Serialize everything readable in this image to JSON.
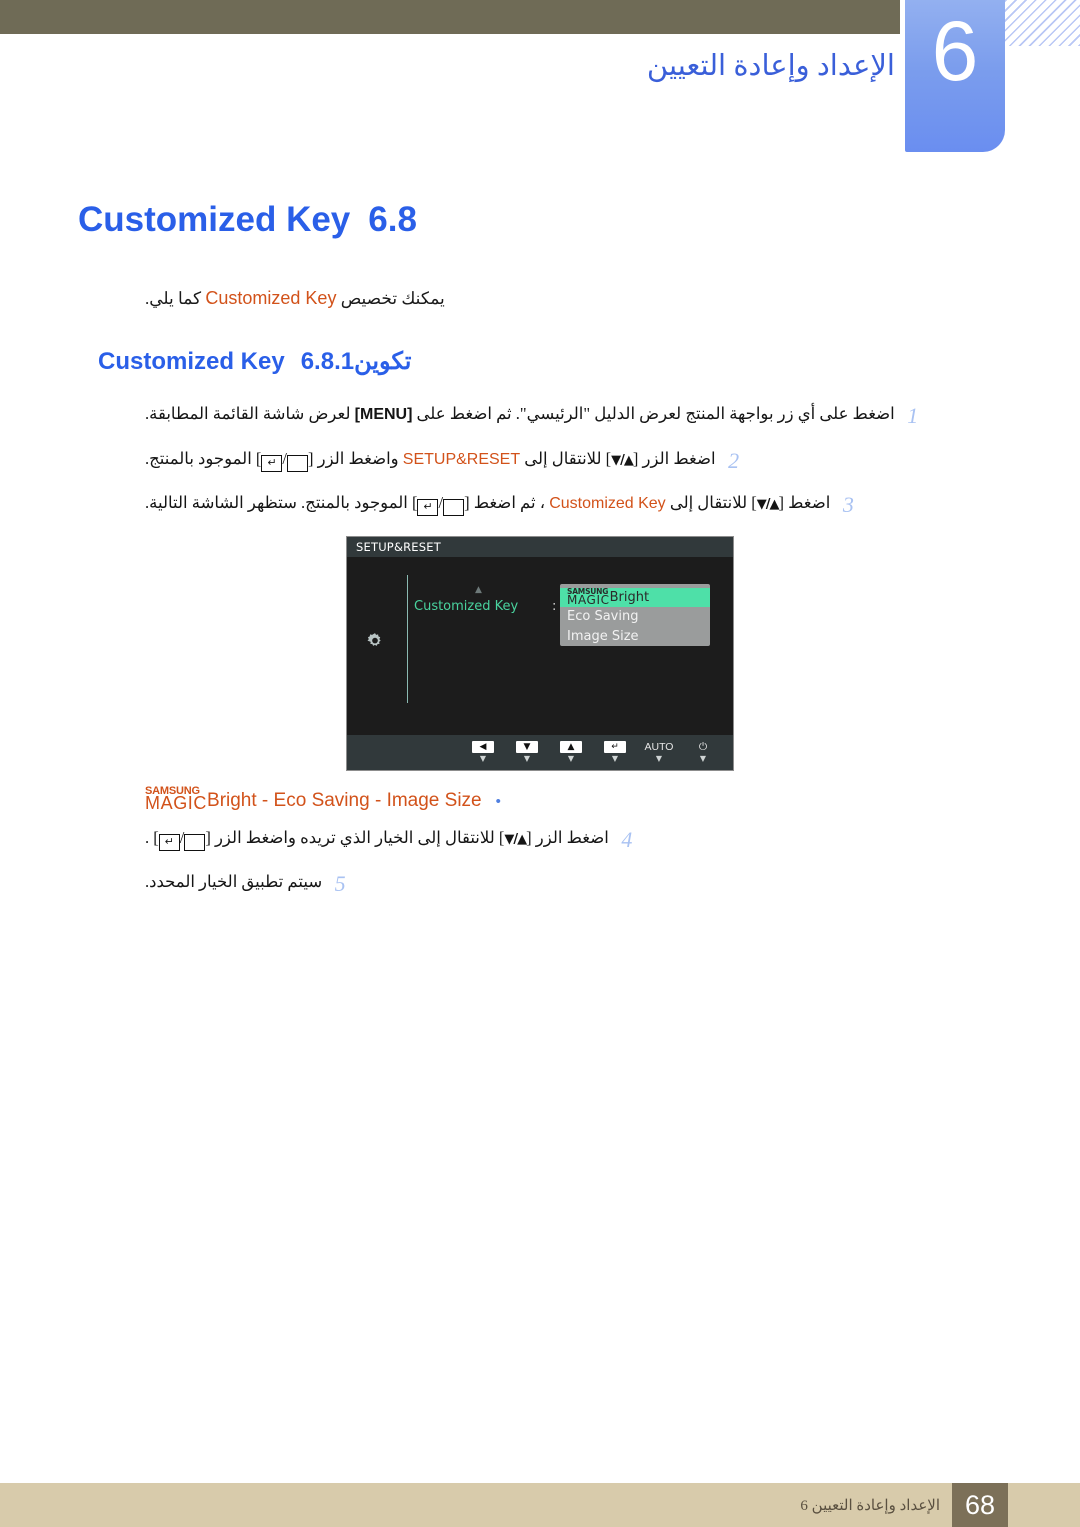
{
  "header": {
    "chapter_number": "6",
    "chapter_title": "الإعداد وإعادة التعيين"
  },
  "section": {
    "number": "6.8",
    "title": "Customized Key",
    "intro_prefix": "يمكنك تخصيص",
    "intro_term": "Customized Key",
    "intro_suffix": "كما يلي."
  },
  "subsection": {
    "number": "6.8.1",
    "title_latin": "Customized Key",
    "title_arabic": "تكوين"
  },
  "steps": [
    {
      "number": "1",
      "parts": [
        {
          "t": "ar",
          "v": "اضغط على أي زر بواجهة المنتج لعرض الدليل \"الرئيسي\". ثم اضغط على"
        },
        {
          "t": "menu",
          "v": "MENU"
        },
        {
          "t": "ar",
          "v": "لعرض شاشة القائمة المطابقة."
        }
      ]
    },
    {
      "number": "2",
      "parts": [
        {
          "t": "ar",
          "v": "اضغط الزر"
        },
        {
          "t": "updown",
          "v": "▲/▼"
        },
        {
          "t": "ar",
          "v": "للانتقال إلى"
        },
        {
          "t": "orange",
          "v": "SETUP&RESET"
        },
        {
          "t": "ar",
          "v": "واضغط الزر"
        },
        {
          "t": "enterkey",
          "v": "↵"
        },
        {
          "t": "ar",
          "v": "الموجود بالمنتج."
        }
      ]
    },
    {
      "number": "3",
      "parts": [
        {
          "t": "ar",
          "v": "اضغط"
        },
        {
          "t": "updown",
          "v": "▲/▼"
        },
        {
          "t": "ar",
          "v": "للانتقال إلى"
        },
        {
          "t": "orange",
          "v": "Customized Key"
        },
        {
          "t": "ar",
          "v": "، ثم اضغط"
        },
        {
          "t": "enterkey",
          "v": "↵"
        },
        {
          "t": "ar",
          "v": "الموجود بالمنتج. ستظهر الشاشة التالية."
        }
      ]
    }
  ],
  "steps_tail": [
    {
      "number": "4",
      "parts": [
        {
          "t": "ar",
          "v": "اضغط الزر"
        },
        {
          "t": "updown",
          "v": "▲/▼"
        },
        {
          "t": "ar",
          "v": "للانتقال إلى الخيار الذي تريده واضغط الزر"
        },
        {
          "t": "enterkey",
          "v": "↵"
        },
        {
          "t": "ar",
          "v": "."
        }
      ]
    },
    {
      "number": "5",
      "parts": [
        {
          "t": "ar",
          "v": "سيتم تطبيق الخيار المحدد."
        }
      ]
    }
  ],
  "osd": {
    "header_title": "SETUP&RESET",
    "setting_label": "Customized Key",
    "colon": ":",
    "menu_items": [
      {
        "magic_top": "SAMSUNG",
        "magic_bottom": "MAGIC",
        "suffix": "Bright",
        "selected": true
      },
      {
        "label": "Eco Saving",
        "selected": false
      },
      {
        "label": "Image Size",
        "selected": false
      }
    ],
    "buttons": [
      {
        "glyph": "◀",
        "name": "left-arrow"
      },
      {
        "glyph": "▼",
        "name": "down-arrow"
      },
      {
        "glyph": "▲",
        "name": "up-arrow"
      },
      {
        "glyph": "↵",
        "name": "enter"
      },
      {
        "glyph": "AUTO",
        "name": "auto"
      },
      {
        "glyph": "⏻",
        "name": "power"
      }
    ]
  },
  "bullet": {
    "magic_top": "SAMSUNG",
    "magic_bottom": "MAGIC",
    "magic_suffix": "Bright",
    "sep": " - ",
    "item2": "Eco Saving",
    "item3": "Image Size"
  },
  "footer": {
    "page_number": "68",
    "text": "الإعداد وإعادة التعيين 6"
  },
  "colors": {
    "accent_blue": "#2a5fe8",
    "orange": "#d2521a",
    "tab_blue": "#7b9ded",
    "header_band": "#6f6b56",
    "footer_bg": "#d8cbab",
    "footer_box": "#7c7058",
    "osd_green": "#4ee0a8"
  }
}
